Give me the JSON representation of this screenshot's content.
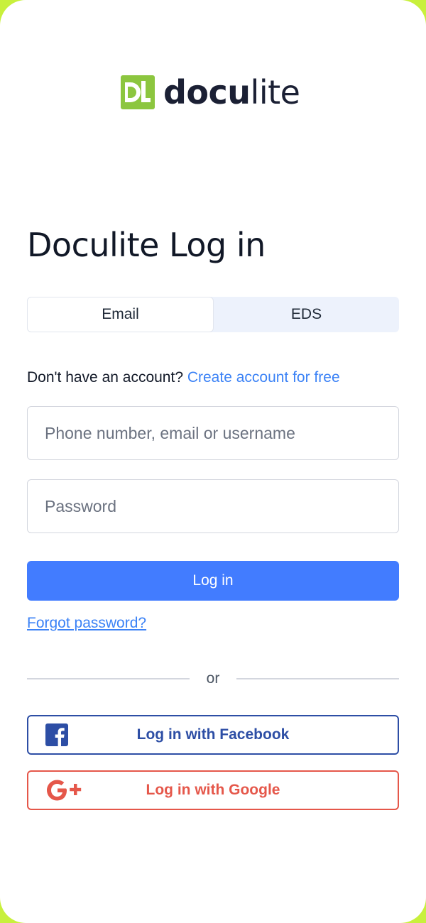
{
  "brand": {
    "name_bold": "docu",
    "name_light": "lite",
    "mark_color": "#8cc63f"
  },
  "page": {
    "title": "Doculite Log in"
  },
  "tabs": [
    {
      "label": "Email",
      "active": true
    },
    {
      "label": "EDS",
      "active": false
    }
  ],
  "signup": {
    "prompt": "Don't have an account?",
    "link": "Create account for free"
  },
  "form": {
    "username_placeholder": "Phone number, email or username",
    "username_value": "",
    "password_placeholder": "Password",
    "password_value": "",
    "submit_label": "Log in",
    "forgot_label": "Forgot password?"
  },
  "divider": {
    "label": "or"
  },
  "social": {
    "facebook_label": "Log in with Facebook",
    "facebook_icon": "facebook-icon",
    "facebook_color": "#2d4ea5",
    "google_label": "Log in with Google",
    "google_icon": "google-plus-icon",
    "google_color": "#e5574a"
  },
  "colors": {
    "accent": "#427cff",
    "link": "#3b82f6",
    "frame": "#c8f03c"
  }
}
